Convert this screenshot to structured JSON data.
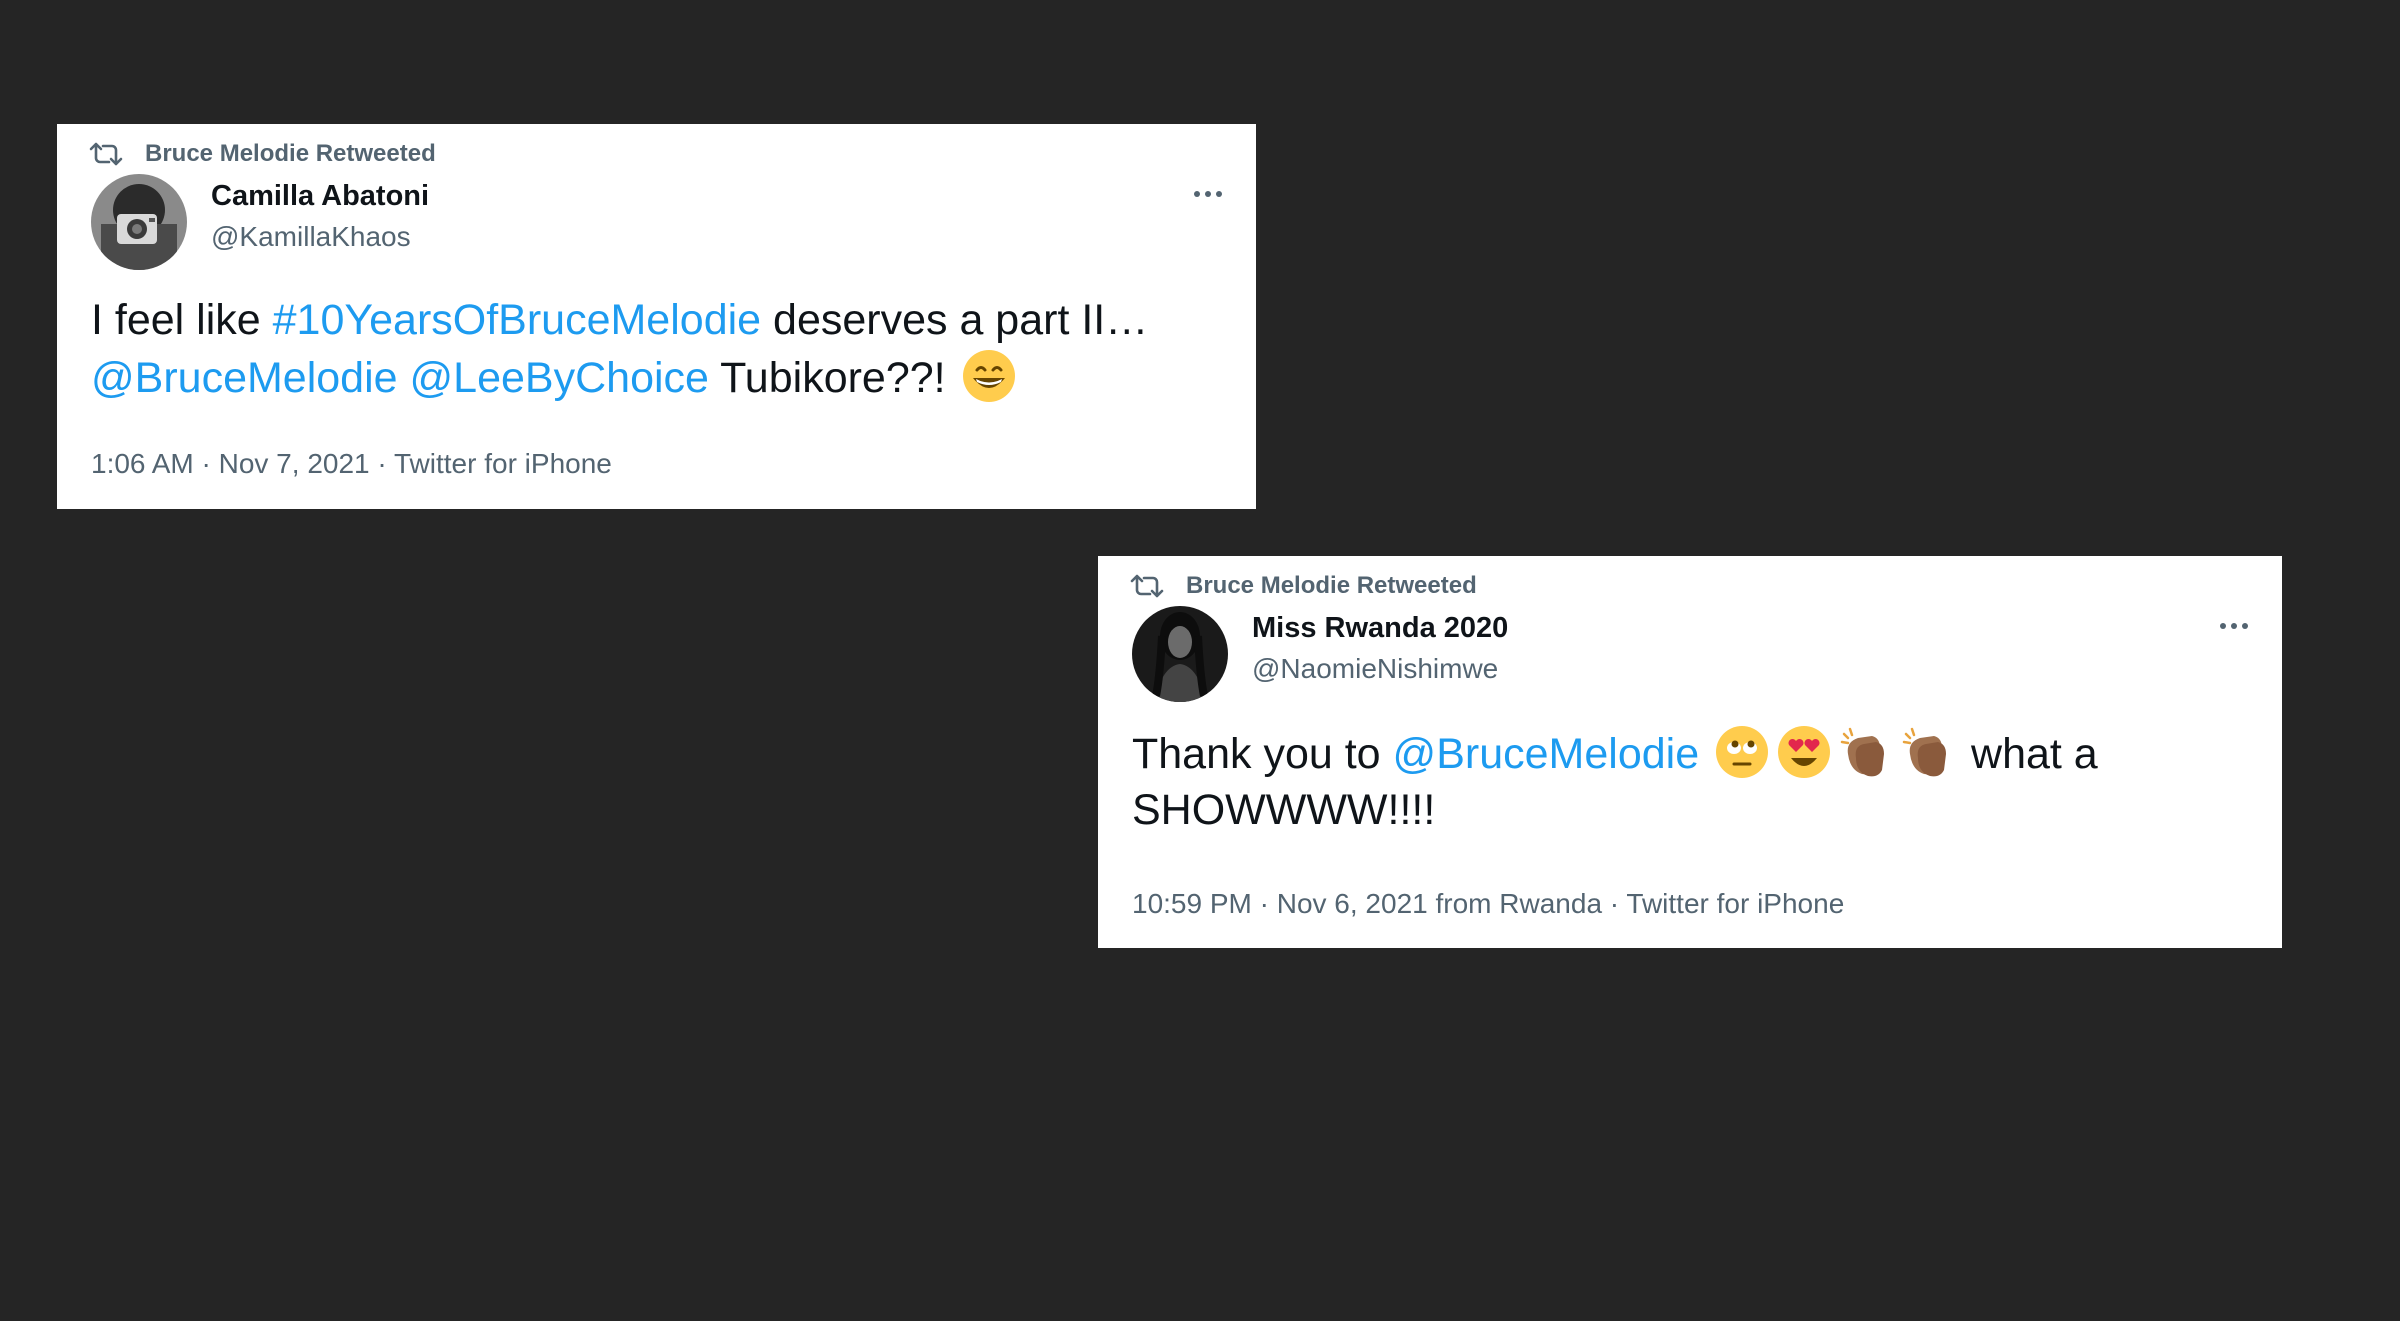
{
  "tweets": [
    {
      "retweet_label": "Bruce Melodie Retweeted",
      "display_name": "Camilla Abatoni",
      "handle": "@KamillaKhaos",
      "text_1": "I feel like ",
      "hashtag": "#10YearsOfBruceMelodie",
      "text_2": " deserves a part II…",
      "mention_1": "@BruceMelodie",
      "mention_2": "@LeeByChoice",
      "text_3": " Tubikore??! ",
      "emoji": "grinning-face-with-smiling-eyes",
      "meta": "1:06 AM · Nov 7, 2021 · Twitter for iPhone"
    },
    {
      "retweet_label": "Bruce Melodie Retweeted",
      "display_name": "Miss Rwanda 2020",
      "handle": "@NaomieNishimwe",
      "text_1": "Thank you to ",
      "mention_1": "@BruceMelodie",
      "emojis": [
        "face-with-rolling-eyes",
        "smiling-face-with-heart-eyes",
        "clapping-hands-medium-dark-skin",
        "clapping-hands-medium-dark-skin"
      ],
      "text_2": " what a SHOWWWW!!!!",
      "meta": "10:59 PM · Nov 6, 2021 from Rwanda · Twitter for iPhone"
    }
  ],
  "colors": {
    "background": "#252525",
    "card": "#ffffff",
    "link": "#1d9bf0",
    "secondary_text": "#536471",
    "primary_text": "#0f1419"
  }
}
